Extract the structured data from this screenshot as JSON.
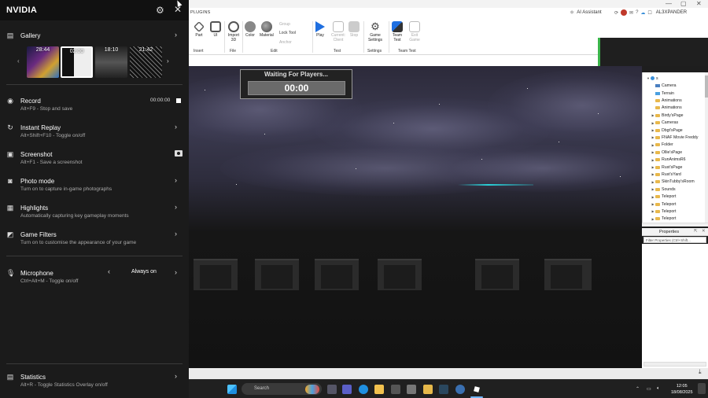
{
  "nvidia": {
    "title": "NVIDIA",
    "gallery": {
      "label": "Gallery",
      "thumbnails": [
        {
          "time": "28:44",
          "selected": false
        },
        {
          "time": "02:00",
          "selected": true
        },
        {
          "time": "18:10",
          "selected": false
        },
        {
          "time": "21:42",
          "selected": false
        }
      ]
    },
    "record": {
      "label": "Record",
      "sub": "Alt+F9 - Stop and save",
      "time": "00:00:00"
    },
    "instant_replay": {
      "label": "Instant Replay",
      "sub": "Alt+Shift+F10 - Toggle on/off"
    },
    "screenshot": {
      "label": "Screenshot",
      "sub": "Alt+F1 - Save a screenshot"
    },
    "photo_mode": {
      "label": "Photo mode",
      "sub": "Turn on to capture in-game photographs"
    },
    "highlights": {
      "label": "Highlights",
      "sub": "Automatically capturing key gameplay moments"
    },
    "game_filters": {
      "label": "Game Filters",
      "sub": "Turn on to customise the appearance of your game"
    },
    "microphone": {
      "label": "Microphone",
      "sub": "Ctrl+Alt+M - Toggle on/off",
      "value": "Always on"
    },
    "statistics": {
      "label": "Statistics",
      "sub": "Alt+R - Toggle Statistics Overlay on/off"
    }
  },
  "studio": {
    "tab": "PLUGINS",
    "ai_assistant": "AI Assistant",
    "username": "AL3XPANDER",
    "ribbon": {
      "insert": {
        "group": "Insert",
        "part": "Part",
        "ui": "UI"
      },
      "file": {
        "group": "File",
        "import3d": "Import 3D"
      },
      "edit": {
        "group": "Edit",
        "color": "Color",
        "material": "Material",
        "group_btn": "Group",
        "lock_tool": "Lock Tool",
        "anchor": "Anchor"
      },
      "test": {
        "group": "Test",
        "play": "Play",
        "current_client": "Current: Client",
        "stop": "Stop"
      },
      "settings": {
        "group": "Settings",
        "game_settings": "Game Settings"
      },
      "team_test": {
        "group": "Team Test",
        "team_test": "Team Test",
        "exit_game": "Exit Game"
      }
    },
    "viewport": {
      "waiting_text": "Waiting For Players...",
      "timer": "00:00"
    },
    "explorer": {
      "root": "s",
      "items": [
        "Camera",
        "Terrain",
        "Animations",
        "Animations",
        "Birdy'sPage",
        "Cameras",
        "Dbgt'sPage",
        "FNAF Movie Freddy",
        "Folder",
        "Ollie'sPage",
        "RunAnimsR6",
        "Rust'sPage",
        "Rust'sYard",
        "SkinTubby'sRoom",
        "Sounds",
        "Teleport",
        "Teleport",
        "Teleport",
        "Teleport"
      ]
    },
    "properties": {
      "title": "Properties",
      "filter_placeholder": "Filter Properties (Ctrl+Shift..."
    }
  },
  "taskbar": {
    "search_placeholder": "Search",
    "time": "12:05",
    "date": "18/08/2025"
  }
}
